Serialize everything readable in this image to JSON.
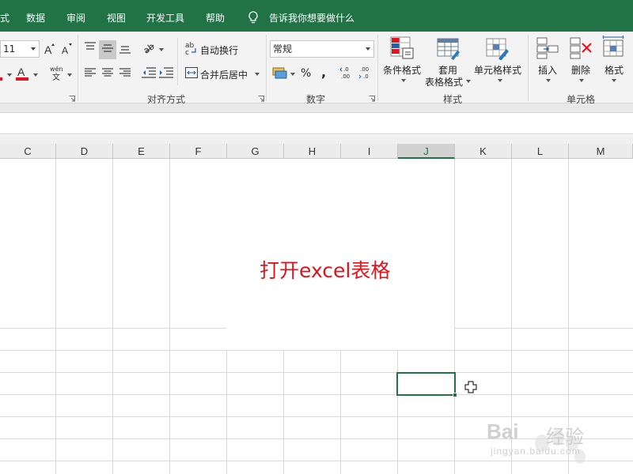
{
  "tabs": [
    {
      "label": "式"
    },
    {
      "label": "数据"
    },
    {
      "label": "审阅"
    },
    {
      "label": "视图"
    },
    {
      "label": "开发工具"
    },
    {
      "label": "帮助"
    }
  ],
  "tellme": {
    "label": "告诉我你想要做什么"
  },
  "font": {
    "size": "11",
    "phonetic_label": "wén\n文"
  },
  "alignment": {
    "wrap_text": "自动换行",
    "merge_center": "合并后居中",
    "group_label": "对齐方式"
  },
  "number": {
    "format_value": "常规",
    "group_label": "数字",
    "percent": "%",
    "comma": ","
  },
  "styles": {
    "conditional": "条件格式",
    "table_format_l1": "套用",
    "table_format_l2": "表格格式",
    "cell_styles": "单元格样式",
    "group_label": "样式"
  },
  "cells": {
    "insert": "插入",
    "delete": "删除",
    "format": "格式",
    "group_label": "单元格"
  },
  "columns": [
    "C",
    "D",
    "E",
    "F",
    "G",
    "H",
    "I",
    "J",
    "K",
    "L",
    "M"
  ],
  "selected_column": "J",
  "annotation": "打开excel表格",
  "watermark": {
    "brand": "Bai",
    "brand_cn": "经验",
    "url": "jingyan.baidu.com"
  },
  "icons": {
    "accent": "#217346",
    "annotation_color": "#e0141e"
  }
}
